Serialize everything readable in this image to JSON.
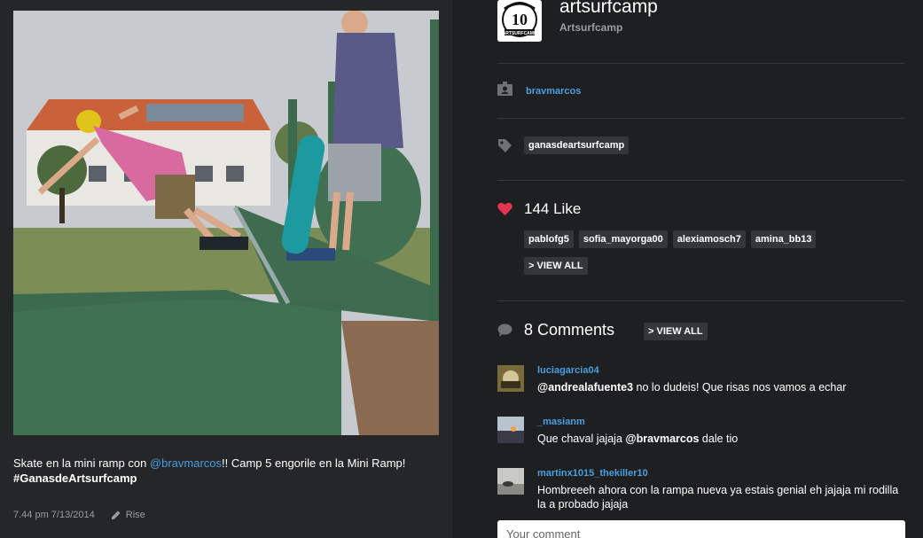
{
  "post": {
    "caption_prefix": "Skate en la mini ramp con ",
    "caption_mention": "@bravmarcos",
    "caption_suffix": "!! Camp 5 engorile en la Mini Ramp!",
    "caption_hashtag": "#GanasdeArtsurfcamp",
    "timestamp": "7.44 pm 7/13/2014",
    "filter_name": "Rise"
  },
  "profile": {
    "logo_text": "10",
    "logo_subtext": "ARTSURFCAMP",
    "username": "artsurfcamp",
    "full_name": "Artsurfcamp"
  },
  "tagged_user": "bravmarcos",
  "tags": [
    "ganasdeartsurfcamp"
  ],
  "likes": {
    "title": "144 Like",
    "users": [
      "pablofg5",
      "sofia_mayorga00",
      "alexiamosch7",
      "amina_bb13"
    ],
    "view_all": "> VIEW ALL"
  },
  "comments": {
    "title": "8 Comments",
    "view_all": "> VIEW ALL",
    "items": [
      {
        "user": "luciagarcia04",
        "mention": "@andrealafuente3",
        "text": " no lo dudeis! Que risas nos vamos a echar"
      },
      {
        "user": "_masianm",
        "text_prefix": "Que chaval jajaja ",
        "mention": "@bravmarcos",
        "text": " dale tio"
      },
      {
        "user": "martinx1015_thekiller10",
        "text": "Hombreeeh ahora con la rampa nueva ya estais genial eh jajaja mi rodilla la a probado jajaja"
      }
    ],
    "input_placeholder": "Your comment"
  },
  "colors": {
    "accent_blue": "#4a9fe0",
    "heart_red": "#e8354f",
    "panel_bg": "#1d1f21"
  }
}
